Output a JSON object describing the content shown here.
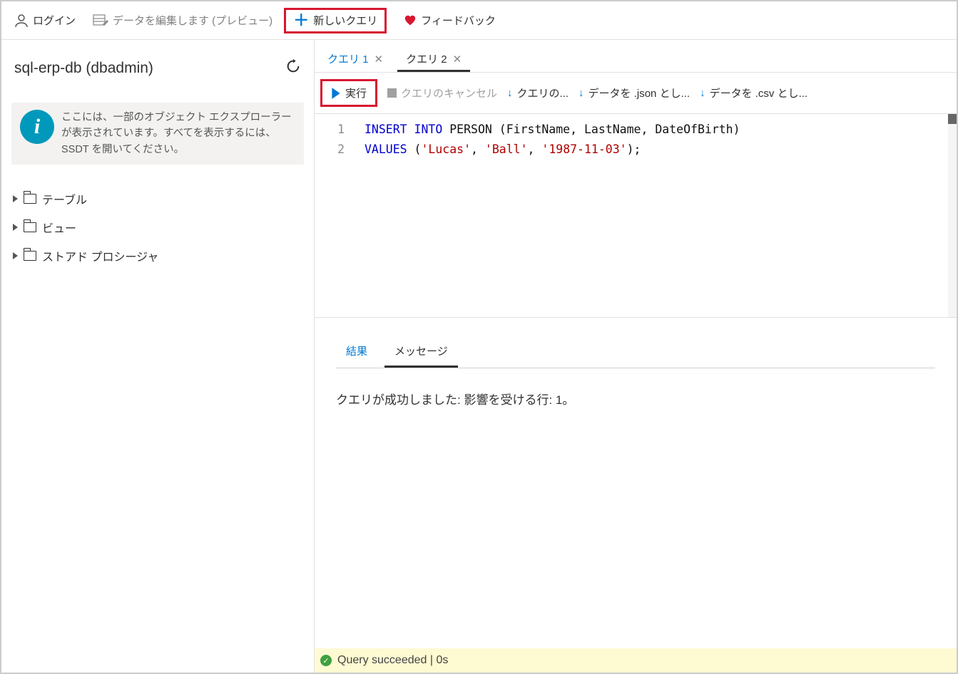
{
  "topbar": {
    "login": "ログイン",
    "edit_data": "データを編集します (プレビュー)",
    "new_query": "新しいクエリ",
    "feedback": "フィードバック"
  },
  "sidebar": {
    "title": "sql-erp-db (dbadmin)",
    "info": "ここには、一部のオブジェクト エクスプローラーが表示されています。すべてを表示するには、SSDT を開いてください。",
    "tree": {
      "tables": "テーブル",
      "views": "ビュー",
      "procs": "ストアド プロシージャ"
    }
  },
  "tabs": {
    "q1": "クエリ 1",
    "q2": "クエリ 2"
  },
  "toolbar": {
    "run": "実行",
    "cancel": "クエリのキャンセル",
    "query_as": "クエリの...",
    "json": "データを .json とし...",
    "csv": "データを .csv とし..."
  },
  "editor": {
    "ln1": "1",
    "ln2": "2",
    "line1": {
      "a": "INSERT INTO",
      "b": " PERSON ",
      "c": "(",
      "d": "FirstName",
      "e": ", ",
      "f": "LastName",
      "g": ", ",
      "h": "DateOfBirth",
      "i": ")"
    },
    "line2": {
      "a": "VALUES",
      "b": " (",
      "c": "'Lucas'",
      "d": ", ",
      "e": "'Ball'",
      "f": ", ",
      "g": "'1987-11-03'",
      "h": ");"
    }
  },
  "lower": {
    "tab_results": "結果",
    "tab_messages": "メッセージ",
    "message": "クエリが成功しました: 影響を受ける行: 1。"
  },
  "status": {
    "text": "Query succeeded | 0s"
  }
}
